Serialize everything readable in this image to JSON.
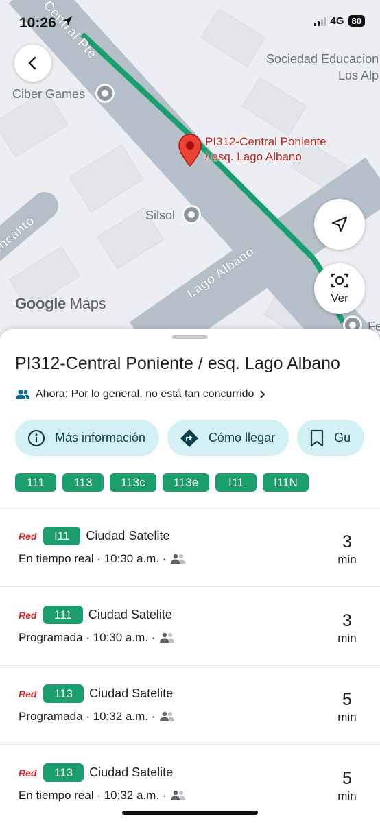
{
  "status_bar": {
    "time": "10:26",
    "network": "4G",
    "battery": "80"
  },
  "map": {
    "street_labels": [
      "Central Pte.",
      "Encanto",
      "Lago Albano"
    ],
    "poi_labels": [
      "Ciber Games",
      "Silsol",
      "Sociedad Educacion",
      "Los Alp",
      "Fe"
    ],
    "stop_label_lines": [
      "PI312-Central Poniente",
      "/ esq. Lago Albano"
    ],
    "logo_google": "Google",
    "logo_maps": "Maps",
    "ver_label": "Ver",
    "colors": {
      "route": "#1b9e6e",
      "road": "#b6c0ca",
      "pin": "#ea4335"
    }
  },
  "sheet": {
    "title": "PI312-Central Poniente / esq. Lago Albano",
    "crowd_text": "Ahora: Por lo general, no está tan concurrido",
    "actions": [
      {
        "label": "Más información",
        "icon": "info-icon"
      },
      {
        "label": "Cómo llegar",
        "icon": "directions-icon"
      },
      {
        "label": "Gu",
        "icon": "bookmark-icon"
      }
    ],
    "routes": [
      "111",
      "113",
      "113c",
      "113e",
      "I11",
      "I11N"
    ],
    "departures": [
      {
        "operator": "Red",
        "route": "I11",
        "destination": "Ciudad Satelite",
        "status": "En tiempo real · 10:30 a.m. ·",
        "eta": "3",
        "unit": "min"
      },
      {
        "operator": "Red",
        "route": "111",
        "destination": "Ciudad Satelite",
        "status": "Programada · 10:30 a.m. ·",
        "eta": "3",
        "unit": "min"
      },
      {
        "operator": "Red",
        "route": "113",
        "destination": "Ciudad Satelite",
        "status": "Programada · 10:32 a.m. ·",
        "eta": "5",
        "unit": "min"
      },
      {
        "operator": "Red",
        "route": "113",
        "destination": "Ciudad Satelite",
        "status": "En tiempo real · 10:32 a.m. ·",
        "eta": "5",
        "unit": "min"
      }
    ]
  }
}
